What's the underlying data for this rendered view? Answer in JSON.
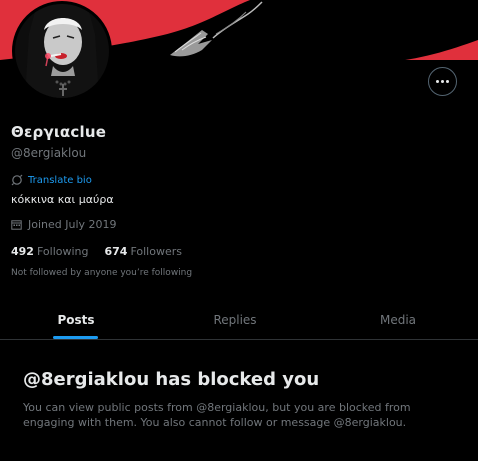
{
  "profile": {
    "display_name": "Θεργιαclue",
    "handle": "@8ergiaklou",
    "translate_bio": "Translate bio",
    "bio": "κόκκινα και μαύρα",
    "joined": "Joined July 2019",
    "following_count": "492",
    "following_label": "Following",
    "followers_count": "674",
    "followers_label": "Followers",
    "followed_note": "Not followed by anyone you’re following"
  },
  "tabs": [
    {
      "label": "Posts",
      "active": true
    },
    {
      "label": "Replies",
      "active": false
    },
    {
      "label": "Media",
      "active": false
    }
  ],
  "blocked": {
    "title": "@8ergiaklou has blocked you",
    "description": "You can view public posts from @8ergiaklou, but you are blocked from engaging with them. You also cannot follow or message @8ergiaklou."
  },
  "colors": {
    "background": "#000000",
    "banner_red": "#e0303c",
    "accent": "#1d9bf0",
    "text_primary": "#e7e9ea",
    "text_secondary": "#71767b",
    "border": "#2f3336"
  },
  "icons": {
    "more": "more-options-icon",
    "translate": "translate-icon",
    "joined": "calendar-icon"
  }
}
